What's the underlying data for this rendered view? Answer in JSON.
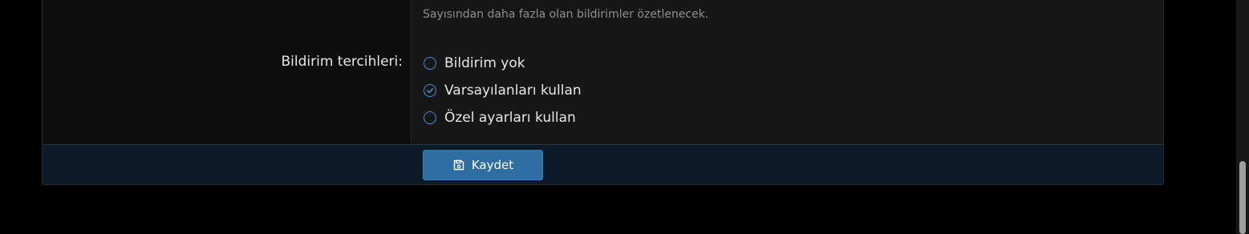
{
  "form": {
    "hint_text": "Sayısından daha fazla olan bildirimler özetlenecek.",
    "preference_label": "Bildirim tercihleri:",
    "options": [
      {
        "label": "Bildirim yok",
        "selected": false
      },
      {
        "label": "Varsayılanları kullan",
        "selected": true
      },
      {
        "label": "Özel ayarları kullan",
        "selected": false
      }
    ]
  },
  "footer": {
    "save_label": "Kaydet"
  },
  "colors": {
    "accent": "#3e8ed8",
    "button": "#2e6da1",
    "footer_bg": "#0c1a27"
  },
  "icons": {
    "save": "floppy-disk-icon",
    "checked": "check-circle-icon"
  }
}
